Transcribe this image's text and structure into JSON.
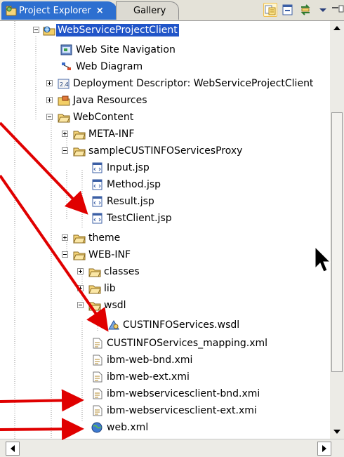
{
  "tabs": {
    "project_explorer": {
      "label": "Project Explorer",
      "close": "×",
      "icon": "project-explorer-icon"
    },
    "gallery": {
      "label": "Gallery",
      "icon": "gallery-icon"
    }
  },
  "toolbar": {
    "link_icon": "link-with-editor-icon",
    "collapse_icon": "collapse-all-icon",
    "sync_icon": "sync-icon",
    "menu_icon": "view-menu-icon",
    "minimize_icon": "minimize-icon"
  },
  "tree": {
    "items": [
      {
        "label": "WebServiceProjectClient",
        "icon": "web-project-icon",
        "expanded": true,
        "selected": true
      },
      {
        "label": "Web Site Navigation",
        "icon": "site-navigation-icon"
      },
      {
        "label": "Web Diagram",
        "icon": "web-diagram-icon"
      },
      {
        "label": "Deployment Descriptor: WebServiceProjectClient",
        "icon": "deployment-descriptor-icon",
        "expanded": false
      },
      {
        "label": "Java Resources",
        "icon": "java-resources-icon",
        "expanded": false
      },
      {
        "label": "WebContent",
        "icon": "folder-icon",
        "expanded": true
      },
      {
        "label": "META-INF",
        "icon": "folder-icon",
        "expanded": false
      },
      {
        "label": "sampleCUSTINFOServicesProxy",
        "icon": "folder-icon",
        "expanded": true
      },
      {
        "label": "Input.jsp",
        "icon": "jsp-file-icon"
      },
      {
        "label": "Method.jsp",
        "icon": "jsp-file-icon"
      },
      {
        "label": "Result.jsp",
        "icon": "jsp-file-icon"
      },
      {
        "label": "TestClient.jsp",
        "icon": "jsp-file-icon"
      },
      {
        "label": "theme",
        "icon": "folder-icon",
        "expanded": false
      },
      {
        "label": "WEB-INF",
        "icon": "folder-icon",
        "expanded": true
      },
      {
        "label": "classes",
        "icon": "folder-icon",
        "expanded": false
      },
      {
        "label": "lib",
        "icon": "folder-icon",
        "expanded": false
      },
      {
        "label": "wsdl",
        "icon": "folder-icon",
        "expanded": true
      },
      {
        "label": "CUSTINFOServices.wsdl",
        "icon": "wsdl-file-icon"
      },
      {
        "label": "CUSTINFOServices_mapping.xml",
        "icon": "xml-file-icon"
      },
      {
        "label": "ibm-web-bnd.xmi",
        "icon": "xmi-file-icon"
      },
      {
        "label": "ibm-web-ext.xmi",
        "icon": "xmi-file-icon"
      },
      {
        "label": "ibm-webservicesclient-bnd.xmi",
        "icon": "xmi-file-icon"
      },
      {
        "label": "ibm-webservicesclient-ext.xmi",
        "icon": "xmi-file-icon"
      },
      {
        "label": "web.xml",
        "icon": "web-xml-icon"
      }
    ]
  },
  "colors": {
    "selection": "#2155c8",
    "active_tab": "#2d6fd0",
    "annotation_arrow": "#e00000",
    "folder": "#f2c75c"
  }
}
